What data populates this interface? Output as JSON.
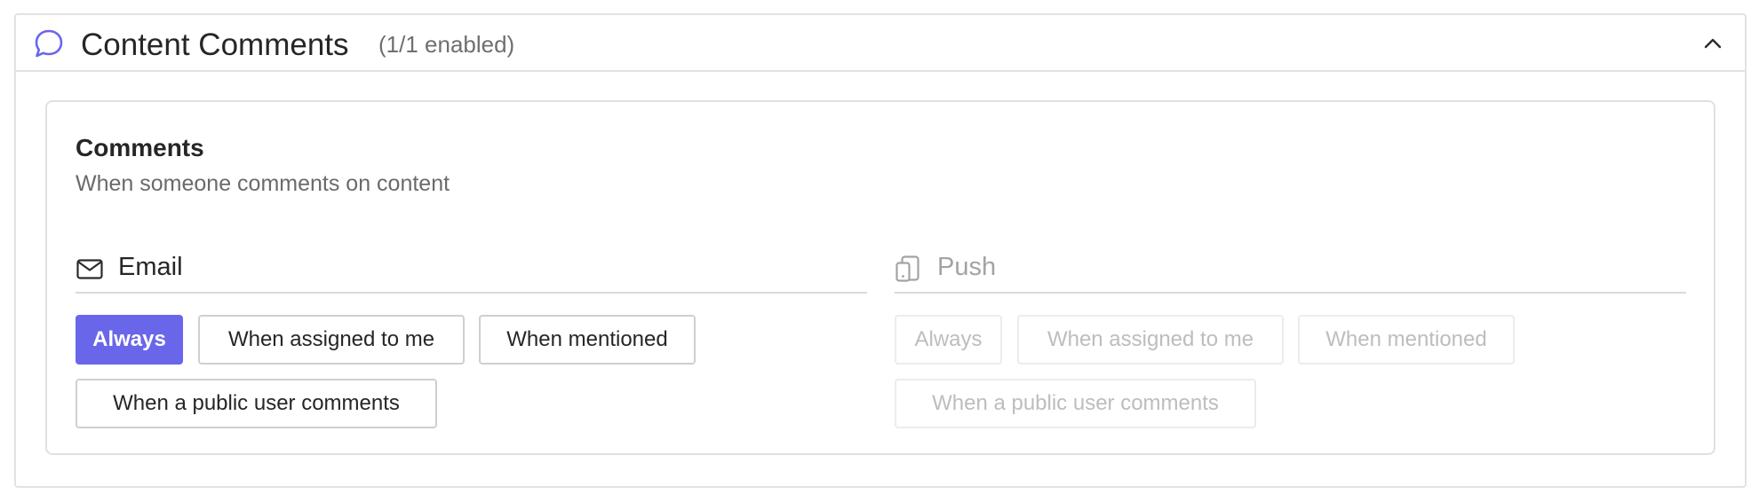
{
  "section": {
    "title": "Content Comments",
    "count": "(1/1 enabled)",
    "icon": "chat-bubble-icon",
    "accent": "#6a66ea"
  },
  "card": {
    "title": "Comments",
    "description": "When someone comments on content"
  },
  "email": {
    "label": "Email",
    "icon": "envelope-icon",
    "options": [
      "Always",
      "When assigned to me",
      "When mentioned",
      "When a public user comments"
    ],
    "selected": "Always"
  },
  "push": {
    "label": "Push",
    "icon": "mobile-device-icon",
    "disabled": true,
    "options": [
      "Always",
      "When assigned to me",
      "When mentioned",
      "When a public user comments"
    ]
  }
}
